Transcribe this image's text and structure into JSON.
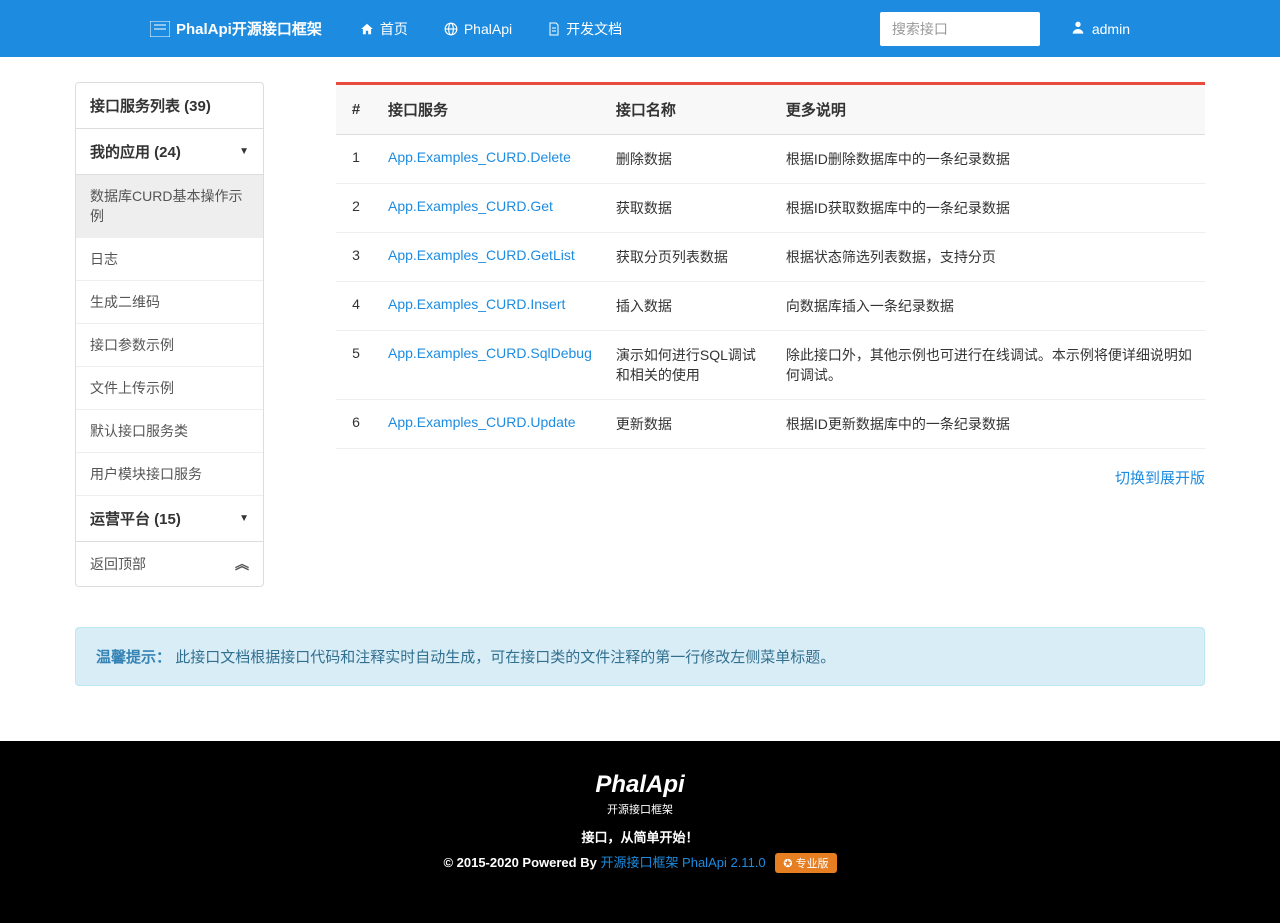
{
  "brand": "PhalApi开源接口框架",
  "nav": {
    "home": "首页",
    "phalapi": "PhalApi",
    "docs": "开发文档"
  },
  "search": {
    "placeholder": "搜索接口"
  },
  "user": {
    "name": "admin"
  },
  "sidebar": {
    "title": "接口服务列表 (39)",
    "group1": "我的应用 (24)",
    "items": [
      "数据库CURD基本操作示例",
      "日志",
      "生成二维码",
      "接口参数示例",
      "文件上传示例",
      "默认接口服务类",
      "用户模块接口服务"
    ],
    "group2": "运营平台 (15)",
    "back_top": "返回顶部"
  },
  "table": {
    "headers": {
      "num": "#",
      "service": "接口服务",
      "name": "接口名称",
      "desc": "更多说明"
    },
    "rows": [
      {
        "n": "1",
        "service": "App.Examples_CURD.Delete",
        "name": "删除数据",
        "desc": "根据ID删除数据库中的一条纪录数据"
      },
      {
        "n": "2",
        "service": "App.Examples_CURD.Get",
        "name": "获取数据",
        "desc": "根据ID获取数据库中的一条纪录数据"
      },
      {
        "n": "3",
        "service": "App.Examples_CURD.GetList",
        "name": "获取分页列表数据",
        "desc": "根据状态筛选列表数据，支持分页"
      },
      {
        "n": "4",
        "service": "App.Examples_CURD.Insert",
        "name": "插入数据",
        "desc": "向数据库插入一条纪录数据"
      },
      {
        "n": "5",
        "service": "App.Examples_CURD.SqlDebug",
        "name": "演示如何进行SQL调试和相关的使用",
        "desc": "除此接口外，其他示例也可进行在线调试。本示例将便详细说明如何调试。"
      },
      {
        "n": "6",
        "service": "App.Examples_CURD.Update",
        "name": "更新数据",
        "desc": "根据ID更新数据库中的一条纪录数据"
      }
    ]
  },
  "switch_link": "切换到展开版",
  "alert": {
    "label": "温馨提示：",
    "text": "此接口文档根据接口代码和注释实时自动生成，可在接口类的文件注释的第一行修改左侧菜单标题。"
  },
  "footer": {
    "logo": "PhalApi",
    "sub": "开源接口框架",
    "tagline": "接口，从简单开始！",
    "copy_prefix": "© 2015-2020 Powered By ",
    "copy_link": "开源接口框架 PhalApi 2.11.0",
    "badge": "✪ 专业版"
  }
}
